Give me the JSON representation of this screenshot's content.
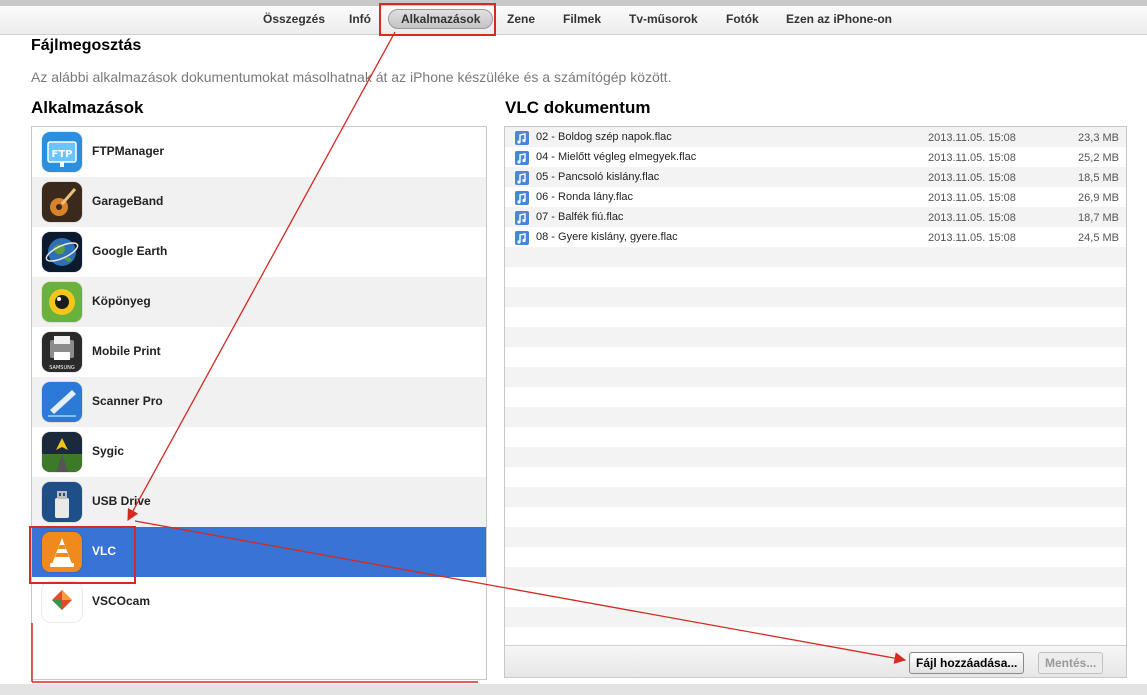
{
  "tabs": [
    {
      "label": "Összegzés"
    },
    {
      "label": "Infó"
    },
    {
      "label": "Alkalmazások",
      "active": true
    },
    {
      "label": "Zene"
    },
    {
      "label": "Filmek"
    },
    {
      "label": "Tv-műsorok"
    },
    {
      "label": "Fotók"
    },
    {
      "label": "Ezen az iPhone-on"
    }
  ],
  "page": {
    "title": "Fájlmegosztás",
    "description": "Az alábbi alkalmazások dokumentumokat másolhatnak át az iPhone készüléke és a számítógép között."
  },
  "apps_section": {
    "title": "Alkalmazások",
    "items": [
      {
        "label": "FTPManager",
        "icon": "ftp-icon"
      },
      {
        "label": "GarageBand",
        "icon": "guitar-icon"
      },
      {
        "label": "Google Earth",
        "icon": "globe-icon"
      },
      {
        "label": "Köpönyeg",
        "icon": "eye-icon"
      },
      {
        "label": "Mobile Print",
        "icon": "printer-icon"
      },
      {
        "label": "Scanner Pro",
        "icon": "scanner-icon"
      },
      {
        "label": "Sygic",
        "icon": "navigation-icon"
      },
      {
        "label": "USB Drive",
        "icon": "usb-icon"
      },
      {
        "label": "VLC",
        "icon": "traffic-cone-icon",
        "selected": true
      },
      {
        "label": "VSCOcam",
        "icon": "vsco-icon"
      }
    ]
  },
  "docs_section": {
    "title": "VLC dokumentum",
    "files": [
      {
        "name": "02 - Boldog szép napok.flac",
        "date": "2013.11.05. 15:08",
        "size": "23,3 MB"
      },
      {
        "name": "04 - Mielőtt végleg elmegyek.flac",
        "date": "2013.11.05. 15:08",
        "size": "25,2 MB"
      },
      {
        "name": "05 - Pancsoló kislány.flac",
        "date": "2013.11.05. 15:08",
        "size": "18,5 MB"
      },
      {
        "name": "06 - Ronda lány.flac",
        "date": "2013.11.05. 15:08",
        "size": "26,9 MB"
      },
      {
        "name": "07 - Balfék fiú.flac",
        "date": "2013.11.05. 15:08",
        "size": "18,7 MB"
      },
      {
        "name": "08 - Gyere kislány, gyere.flac",
        "date": "2013.11.05. 15:08",
        "size": "24,5 MB"
      }
    ],
    "add_button": "Fájl hozzáadása...",
    "save_button": "Mentés..."
  },
  "colors": {
    "selection": "#3873d5",
    "annotation": "#d42a22"
  }
}
